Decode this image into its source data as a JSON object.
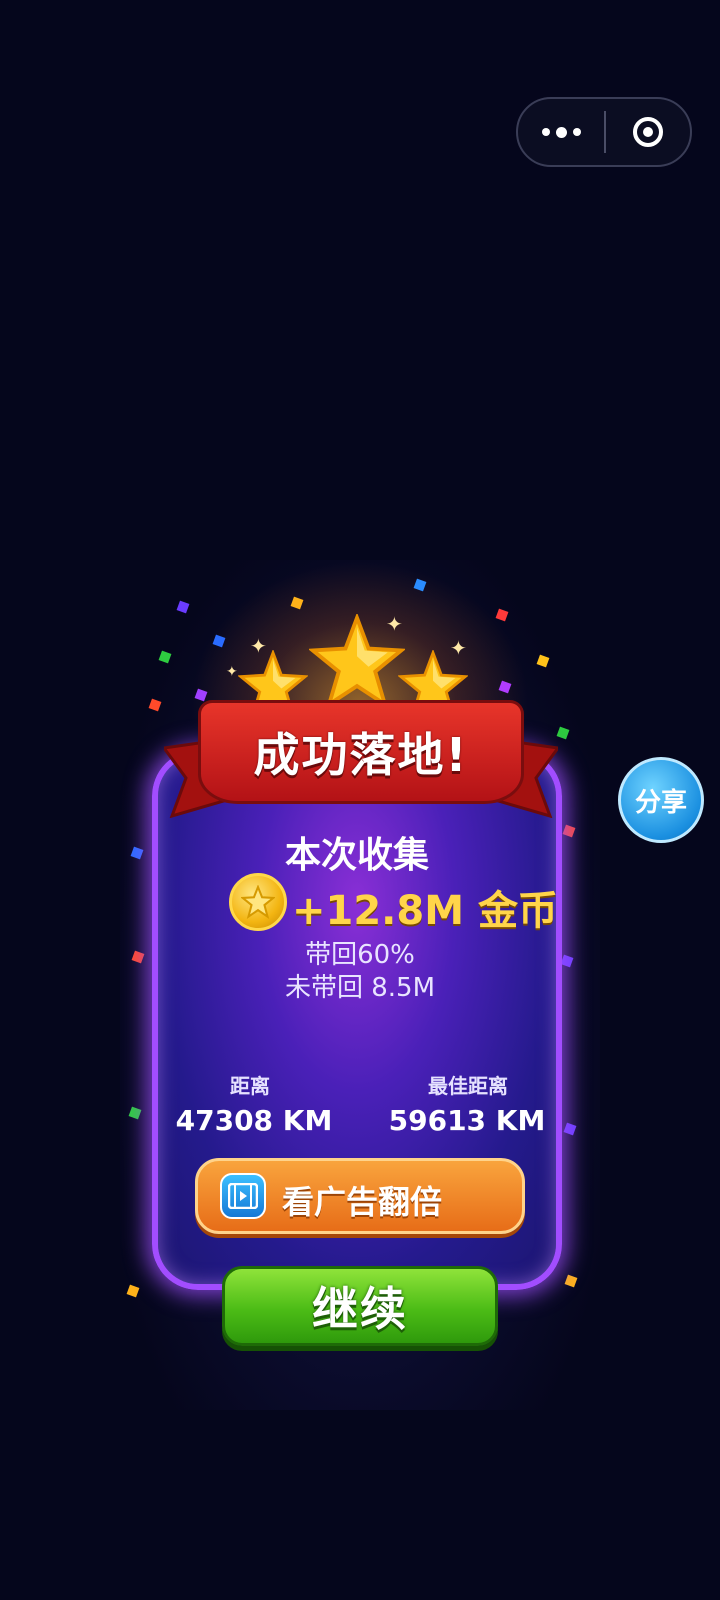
{
  "capsule": {
    "more_icon": "more-dots-icon",
    "close_icon": "target-close-icon"
  },
  "result": {
    "banner": "成功落地!",
    "collect_title": "本次收集",
    "gold_amount": "+12.8M 金币",
    "brought_back": "带回60%",
    "not_brought_back": "未带回 8.5M",
    "stars_earned": 3,
    "stars_total": 3
  },
  "stats": {
    "distance_label": "距离",
    "distance_value": "47308 KM",
    "best_label": "最佳距离",
    "best_value": "59613 KM"
  },
  "buttons": {
    "ad_double": "看广告翻倍",
    "continue": "继续",
    "share": "分享"
  },
  "colors": {
    "panel_border": "#a24dff",
    "ribbon": "#d42a24",
    "gold_text": "#ffd54a",
    "ad_button": "#f08a2a",
    "continue_button": "#4cbc16",
    "share_button": "#1a8fe0"
  }
}
